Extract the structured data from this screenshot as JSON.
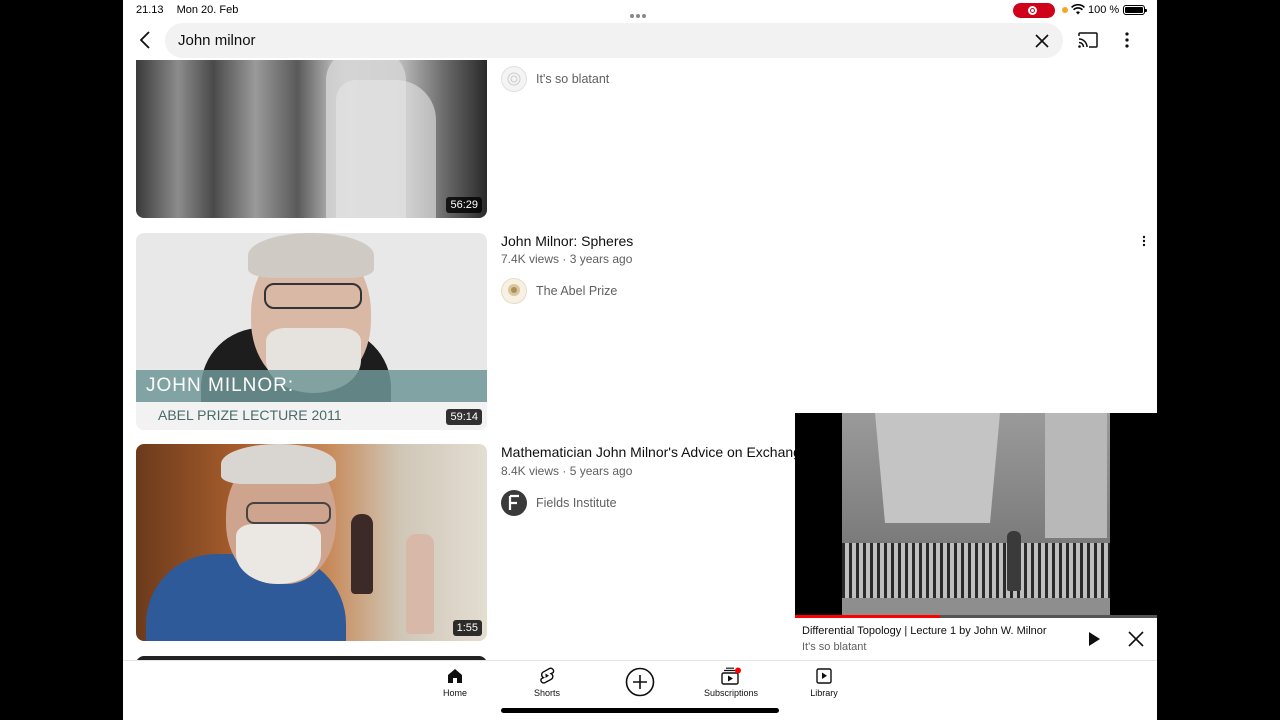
{
  "status_bar": {
    "time": "21.13",
    "date": "Mon 20. Feb",
    "battery": "100 %"
  },
  "search": {
    "query": "John milnor"
  },
  "results": [
    {
      "title": "",
      "channel": "It's so blatant",
      "duration": "56:29"
    },
    {
      "title": "John Milnor: Spheres",
      "meta": "7.4K views · 3 years ago",
      "channel": "The Abel Prize",
      "duration": "59:14",
      "thumb_text_1": "JOHN MILNOR:",
      "thumb_text_2": "ABEL PRIZE LECTURE 2011"
    },
    {
      "title": "Mathematician John Milnor's Advice on Exchanging Ideas",
      "meta": "8.4K views · 5 years ago",
      "channel": "Fields Institute",
      "duration": "1:55"
    }
  ],
  "mini_player": {
    "title": "Differential Topology | Lecture 1  by John W. Milnor",
    "channel": "It's so blatant"
  },
  "nav": {
    "home": "Home",
    "shorts": "Shorts",
    "subscriptions": "Subscriptions",
    "library": "Library"
  },
  "colors": {
    "accent": "#ff0000",
    "text": "#0f0f0f",
    "muted": "#606060"
  }
}
